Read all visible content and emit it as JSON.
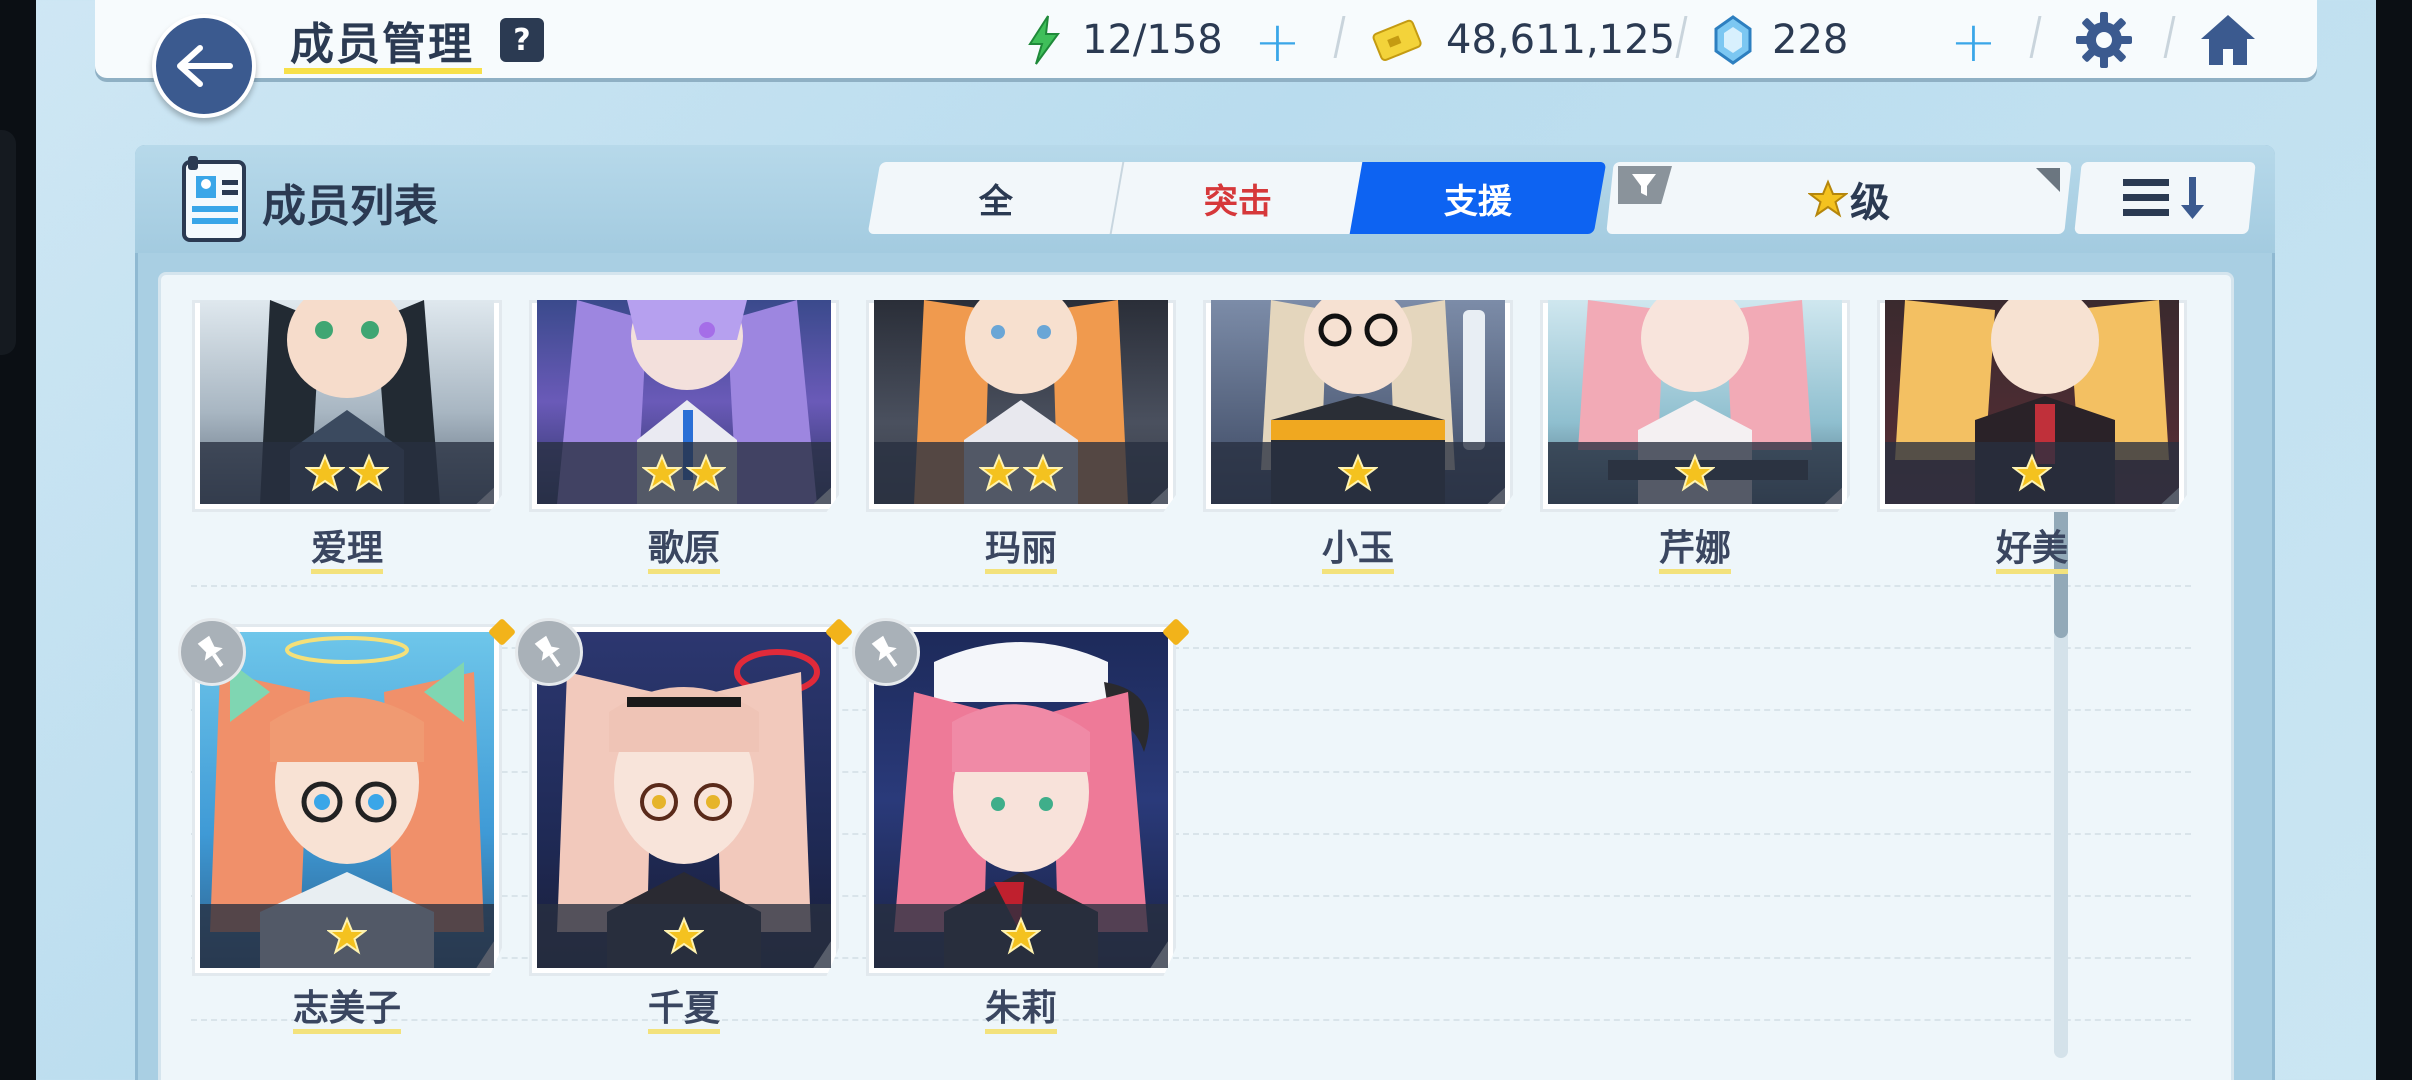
{
  "header": {
    "title": "成员管理",
    "help_label": "?",
    "stamina": "12/158",
    "credits": "48,611,125",
    "gems": "228"
  },
  "panel": {
    "title": "成员列表",
    "tabs": [
      {
        "label": "全",
        "active": false
      },
      {
        "label": "突击",
        "active": false
      },
      {
        "label": "支援",
        "active": true
      }
    ],
    "filter_label": "级",
    "sort_icon": "sort-descending-icon"
  },
  "members": [
    {
      "name": "爱理",
      "stars": 2
    },
    {
      "name": "歌原",
      "stars": 2
    },
    {
      "name": "玛丽",
      "stars": 2
    },
    {
      "name": "小玉",
      "stars": 1
    },
    {
      "name": "芹娜",
      "stars": 1
    },
    {
      "name": "好美",
      "stars": 1
    },
    {
      "name": "志美子",
      "stars": 1
    },
    {
      "name": "千夏",
      "stars": 1
    },
    {
      "name": "朱莉",
      "stars": 1
    }
  ],
  "colors": {
    "accent_blue": "#0d63f2",
    "assault_red": "#d6383a",
    "text_dark": "#2b3a52",
    "star_gold": "#f4c21f"
  }
}
